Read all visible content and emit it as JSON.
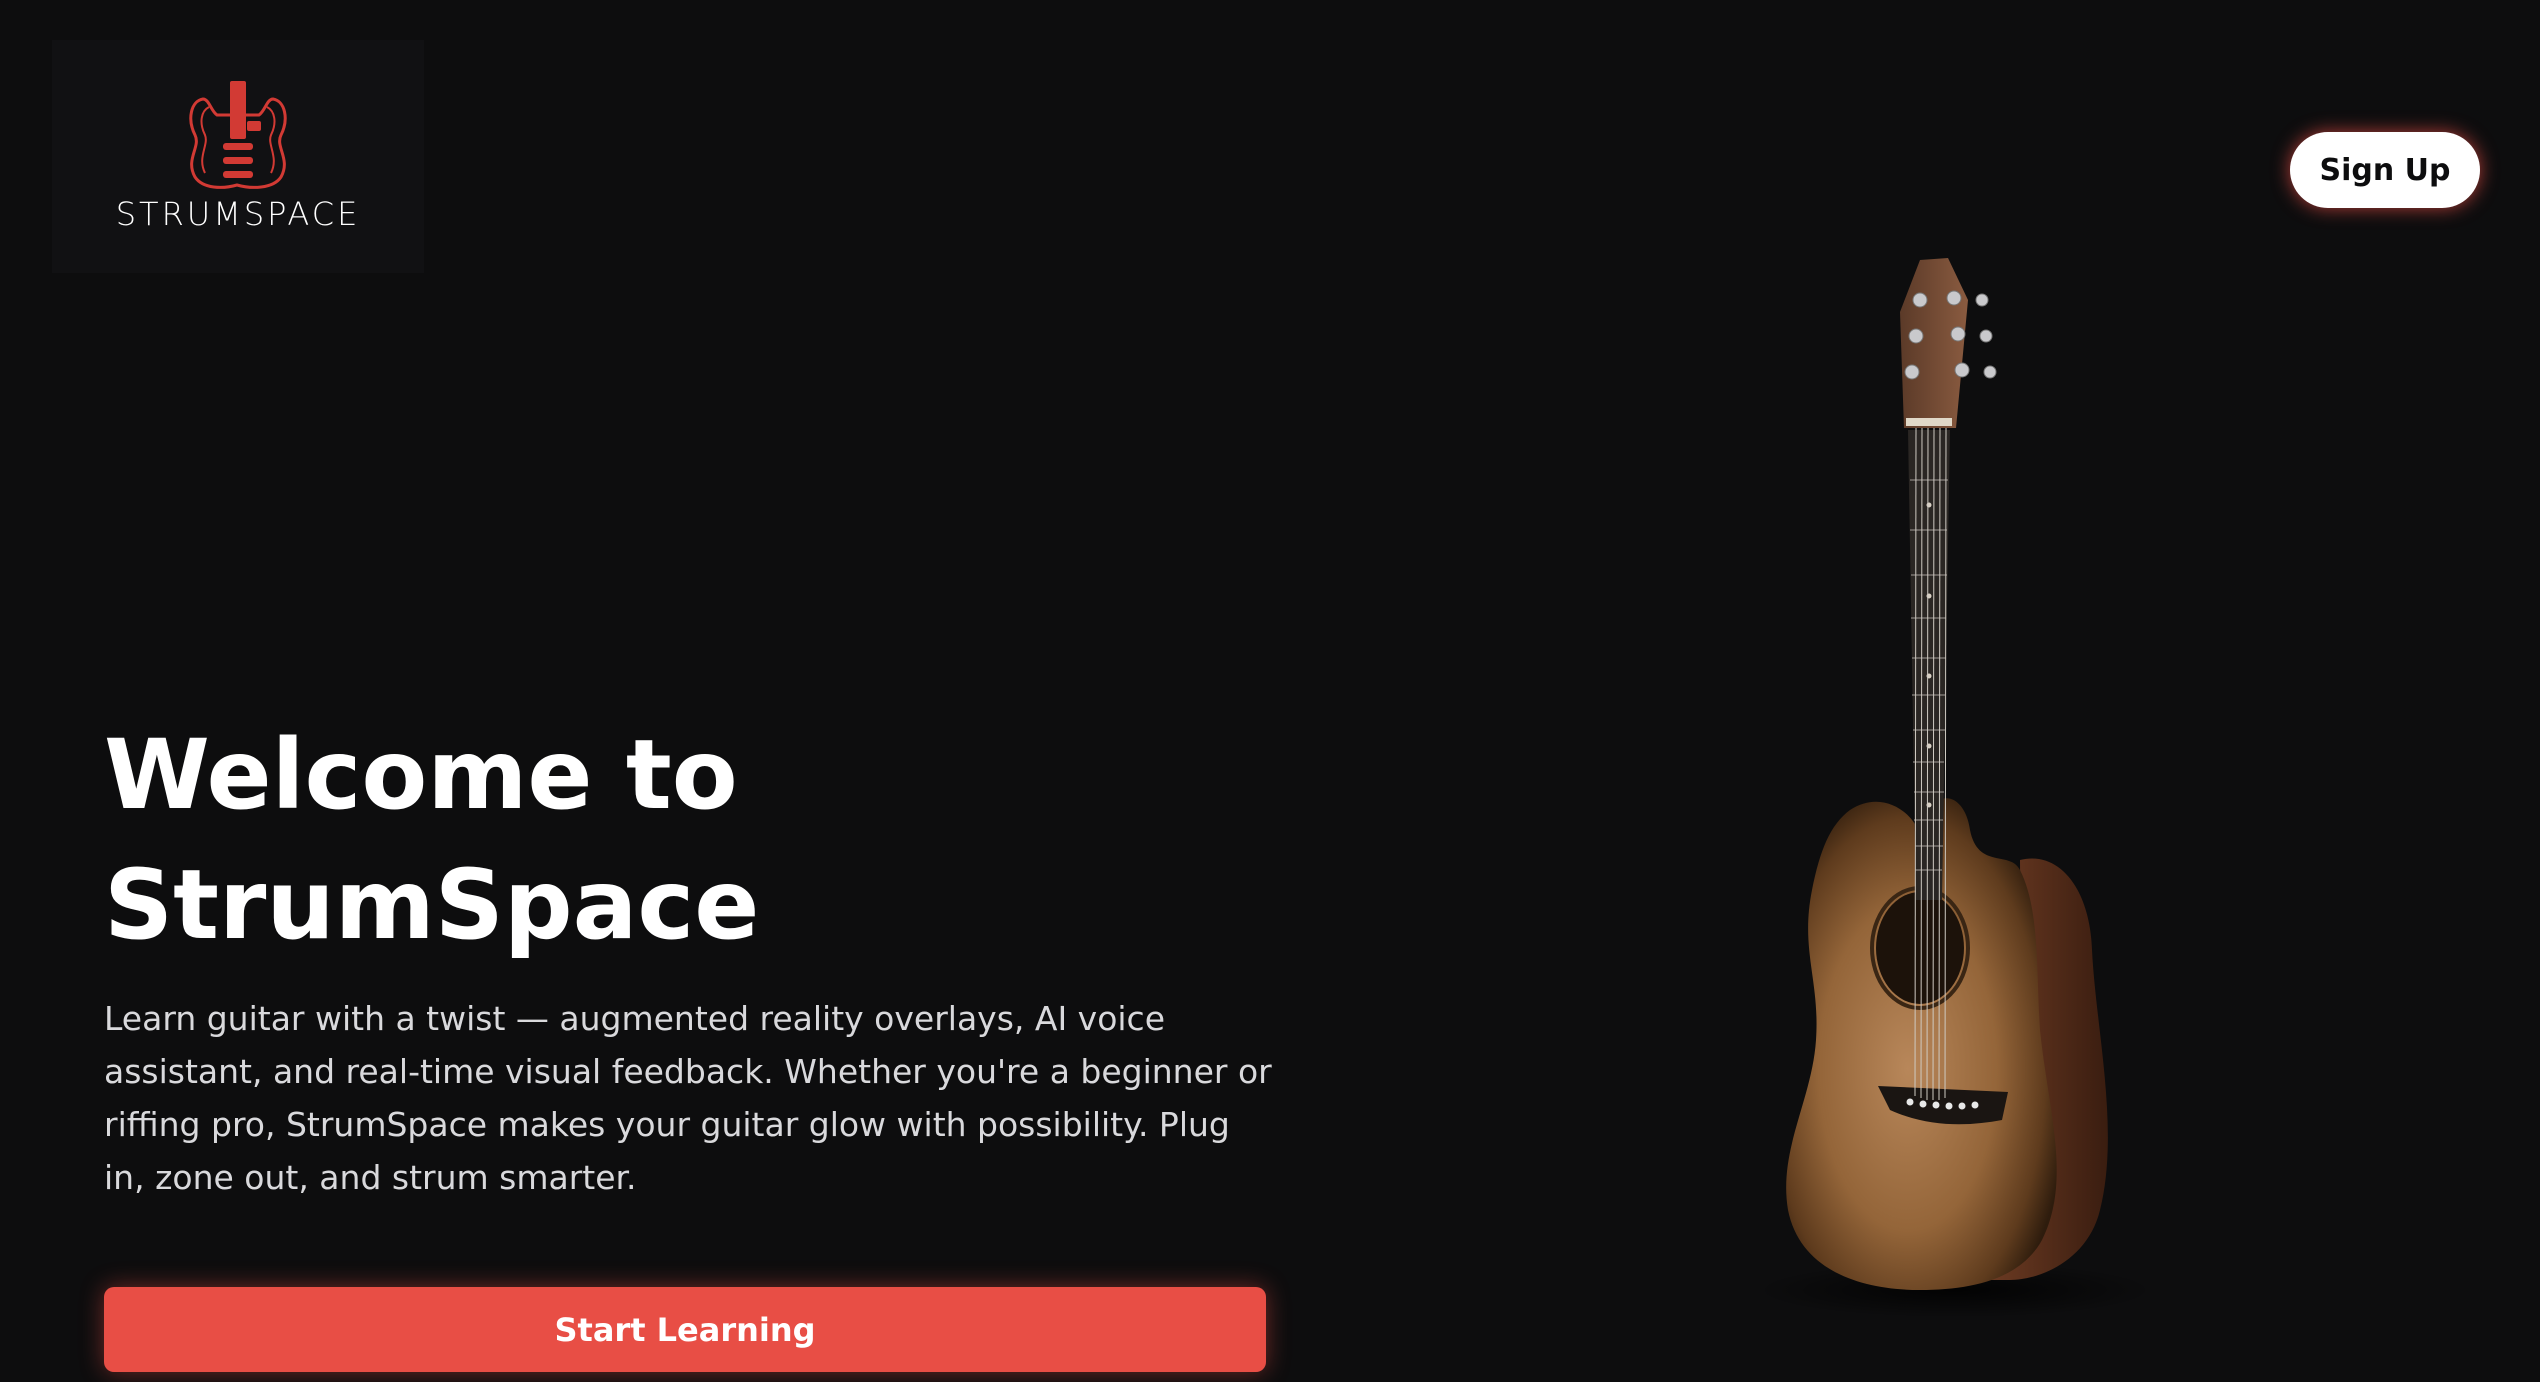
{
  "brand": {
    "logo_text": "STRUMSPACE",
    "accent_color": "#e84e45",
    "background_color": "#0d0d0e"
  },
  "header": {
    "signup_label": "Sign Up"
  },
  "hero": {
    "title_line1": "Welcome to",
    "title_line2": "StrumSpace",
    "description": "Learn guitar with a twist — augmented reality overlays, AI voice assistant, and real-time visual feedback. Whether you're a beginner or riffing pro, StrumSpace makes your guitar glow with possibility. Plug in, zone out, and strum smarter.",
    "cta_label": "Start Learning"
  },
  "icons": {
    "logo": "electric-guitar-logo-icon",
    "hero_image": "acoustic-guitar-illustration"
  }
}
